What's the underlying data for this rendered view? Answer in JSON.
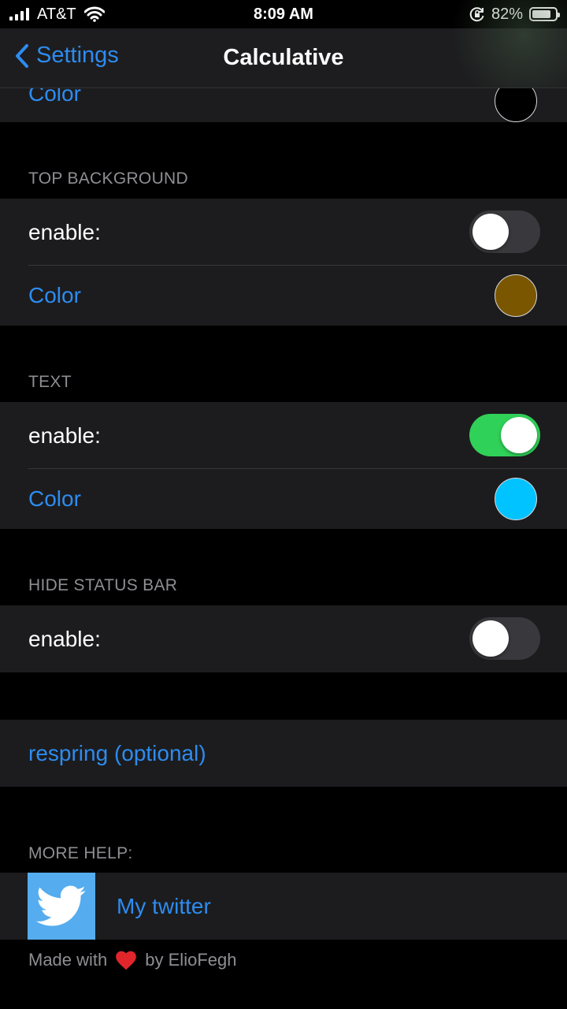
{
  "status_bar": {
    "carrier": "AT&T",
    "time": "8:09 AM",
    "battery_percent": "82%",
    "icons": [
      "cellular-signal-icon",
      "wifi-icon",
      "rotation-lock-icon",
      "battery-icon"
    ]
  },
  "nav": {
    "back_label": "Settings",
    "title": "Calculative"
  },
  "colors": {
    "accent": "#2d8cf0",
    "toggle_on": "#30d158",
    "toggle_off": "#39393d",
    "row_bg": "#1c1c1e"
  },
  "sections": {
    "partial": {
      "color_label": "Color",
      "swatch": "#000000"
    },
    "top_background": {
      "header": "TOP BACKGROUND",
      "enable_label": "enable:",
      "enabled": false,
      "color_label": "Color",
      "swatch": "#7a5600"
    },
    "text": {
      "header": "TEXT",
      "enable_label": "enable:",
      "enabled": true,
      "color_label": "Color",
      "swatch": "#00c3ff"
    },
    "hide_status_bar": {
      "header": "HIDE STATUS BAR",
      "enable_label": "enable:",
      "enabled": false
    },
    "respring": {
      "label": "respring (optional)"
    },
    "more_help": {
      "header": "MORE HELP:",
      "twitter_label": "My twitter"
    }
  },
  "footer": {
    "prefix": "Made with",
    "heart_icon": "heart-icon",
    "suffix": "by ElioFegh"
  }
}
